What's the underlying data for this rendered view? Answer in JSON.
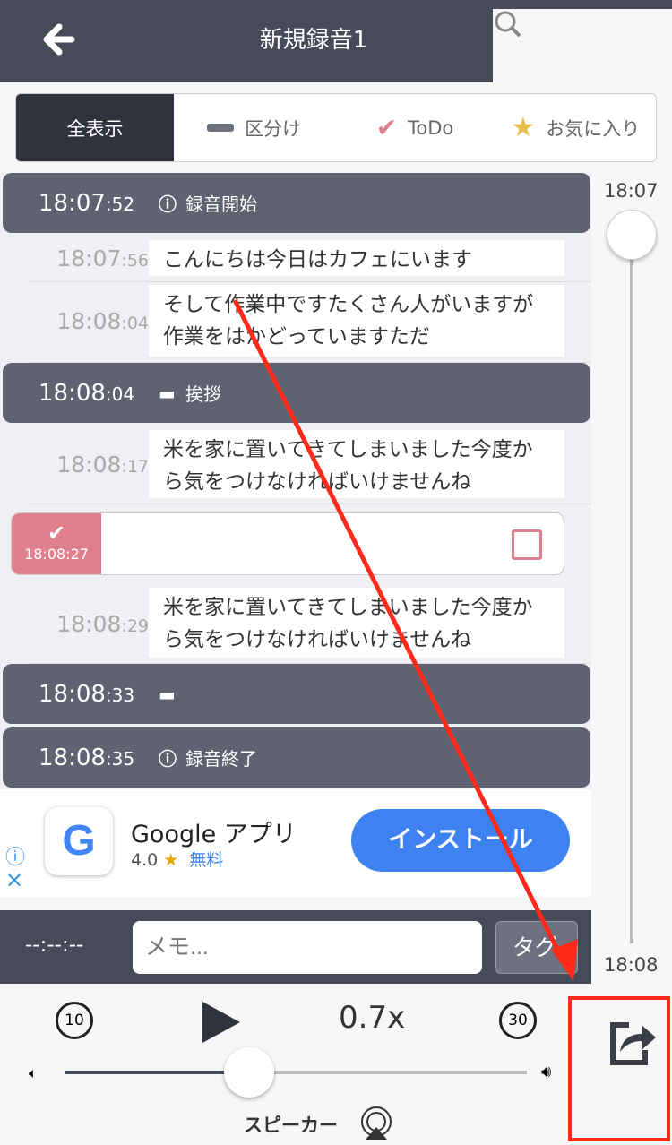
{
  "header": {
    "title": "新規録音1",
    "back_icon": "arrow-left-icon"
  },
  "filters": [
    {
      "label": "全表示",
      "icon": ""
    },
    {
      "label": "区分け",
      "icon": "dash-icon"
    },
    {
      "label": "ToDo",
      "icon": "check-icon"
    },
    {
      "label": "お気に入り",
      "icon": "star-icon"
    }
  ],
  "entries": {
    "s1": {
      "time": "18:07",
      "sec": ":52",
      "label": "録音開始"
    },
    "r1": {
      "time": "18:07",
      "sec": ":56",
      "text": "こんにちは今日はカフェにいます"
    },
    "r2": {
      "time": "18:08",
      "sec": ":04",
      "text": "そして作業中ですたくさん人がいますが作業をはかどっていますただ"
    },
    "s2": {
      "time": "18:08",
      "sec": ":04",
      "label": "挨拶"
    },
    "r3": {
      "time": "18:08",
      "sec": ":17",
      "text": "米を家に置いてきてしまいました今度から気をつけなければいけませんね"
    },
    "todo": {
      "time": "18:08:27"
    },
    "r4": {
      "time": "18:08",
      "sec": ":29",
      "text": "米を家に置いてきてしまいました今度から気をつけなければいけませんね"
    },
    "s3": {
      "time": "18:08",
      "sec": ":33"
    },
    "s4": {
      "time": "18:08",
      "sec": ":35",
      "label": "録音終了"
    }
  },
  "timeline": {
    "start": "18:07",
    "end": "18:08"
  },
  "ad": {
    "name": "Google アプリ",
    "rating": "4.0",
    "price": "無料",
    "install": "インストール"
  },
  "memo": {
    "time": "--:--:--",
    "placeholder": "メモ...",
    "tag": "タグ"
  },
  "player": {
    "speed": "0.7x",
    "back": "10",
    "forward": "30",
    "output": "スピーカー",
    "volume": 0.4
  },
  "colors": {
    "header": "#474b59",
    "section": "#5f6270",
    "todo": "#e0808f",
    "install": "#3d82f0",
    "annotation": "#ff2a1a"
  }
}
